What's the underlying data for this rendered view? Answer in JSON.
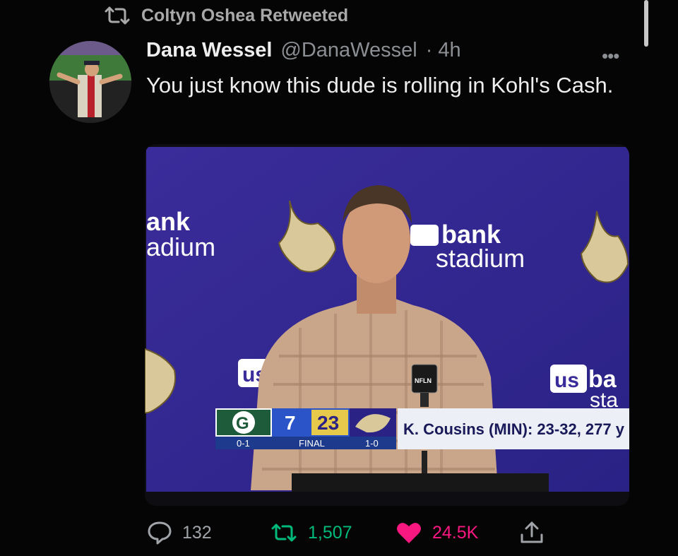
{
  "retweet_banner": {
    "icon": "retweet-icon",
    "text": "Coltyn Oshea Retweeted"
  },
  "tweet": {
    "author_name": "Dana Wessel",
    "handle": "@DanaWessel",
    "time": "· 4h",
    "more_icon": "more-icon",
    "text": "You just know this dude is rolling in Kohl's Cash."
  },
  "media": {
    "backdrop_texts": [
      "ank",
      "adium",
      "bank",
      "stadium",
      "us",
      "us",
      "ba",
      "sta"
    ],
    "scoreboard": {
      "team1_record": "0-1",
      "score1": "7",
      "score2": "23",
      "status": "FINAL",
      "team2_record": "1-0",
      "stat_line": "K. Cousins (MIN): 23-32, 277 y"
    },
    "mic_flag": "NFLN"
  },
  "actions": {
    "replies": "132",
    "retweets": "1,507",
    "likes": "24.5K",
    "colors": {
      "retweet": "#00ba7c",
      "like": "#f91880",
      "neutral": "#a0a4a8"
    }
  }
}
